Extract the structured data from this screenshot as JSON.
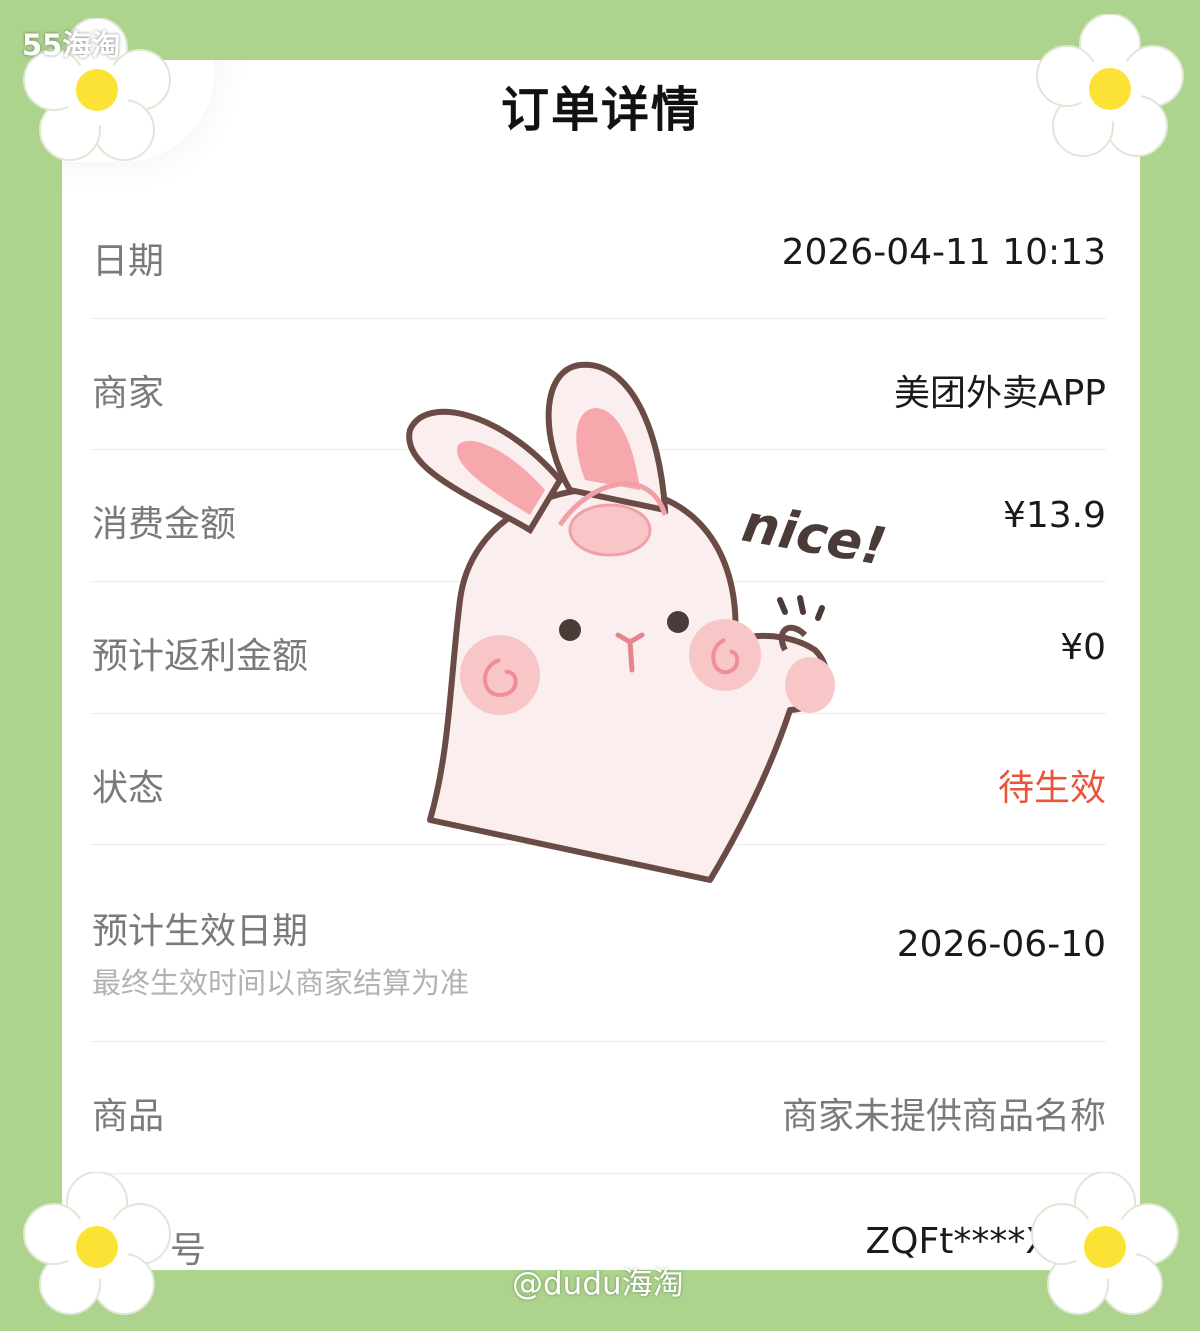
{
  "watermark": {
    "top": "55海淘",
    "bottom": "@dudu海淘"
  },
  "page_title": "订单详情",
  "rows": [
    {
      "label": "日期",
      "value": "2026-04-11 10:13"
    },
    {
      "label": "商家",
      "value": "美团外卖APP"
    },
    {
      "label": "消费金额",
      "value": "¥13.9"
    },
    {
      "label": "预计返利金额",
      "value": "¥0"
    },
    {
      "label": "状态",
      "value": "待生效"
    },
    {
      "label": "预计生效日期",
      "value": "2026-06-10",
      "note": "最终生效时间以商家结算为准"
    },
    {
      "label": "商品",
      "value": "商家未提供商品名称"
    },
    {
      "label": "号",
      "value": "ZQFt****X"
    }
  ],
  "sticker": {
    "text": "nice!"
  },
  "colors": {
    "background": "#acd48c",
    "status": "#e8553b",
    "card": "#ffffff"
  },
  "icons": [
    "flower-icon",
    "bunny-sticker",
    "back-icon"
  ]
}
